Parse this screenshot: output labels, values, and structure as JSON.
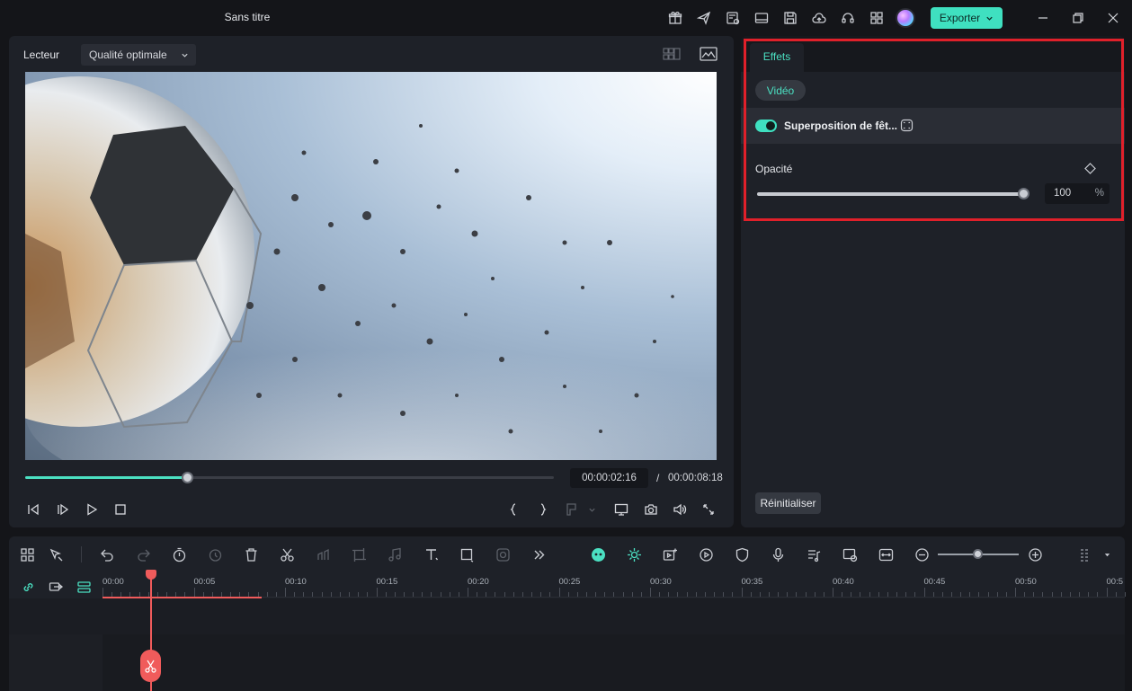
{
  "window": {
    "title": "Sans titre"
  },
  "toolbar": {
    "export_label": "Exporter"
  },
  "player": {
    "label": "Lecteur",
    "quality": "Qualité optimale",
    "current_time": "00:00:02:16",
    "separator": "/",
    "total_time": "00:00:08:18",
    "progress": 0.306
  },
  "effects_panel": {
    "tab": "Effets",
    "category": "Vidéo",
    "effect_name": "Superposition de fêt...",
    "effect_enabled": true,
    "opacity_label": "Opacité",
    "opacity_value": "100",
    "opacity_unit": "%",
    "reset_label": "Réinitialiser"
  },
  "timeline": {
    "ruler_labels": [
      "00:00",
      "00:05",
      "00:10",
      "00:15",
      "00:20",
      "00:25",
      "00:30",
      "00:35",
      "00:40",
      "00:45",
      "00:50",
      "00:5"
    ],
    "zoom_level": 0.5
  },
  "colors": {
    "accent": "#4be0c2",
    "highlight": "#e0202a",
    "playhead": "#f05b5b"
  }
}
